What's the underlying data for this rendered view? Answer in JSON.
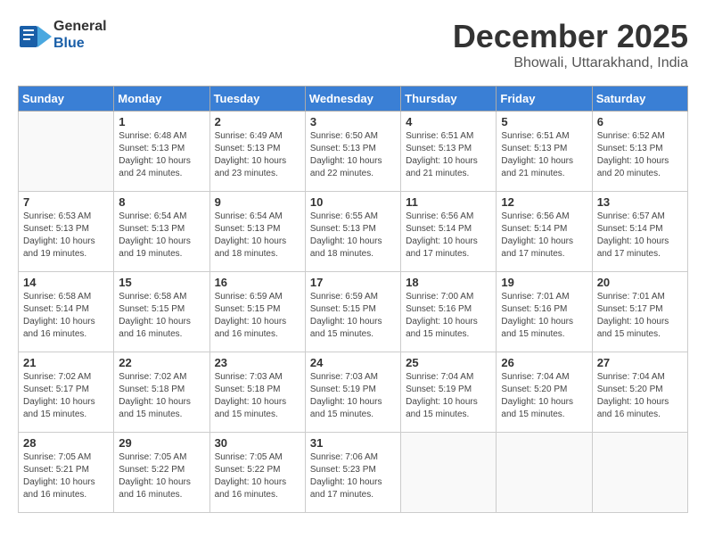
{
  "logo": {
    "general": "General",
    "blue": "Blue"
  },
  "header": {
    "month": "December 2025",
    "location": "Bhowali, Uttarakhand, India"
  },
  "weekdays": [
    "Sunday",
    "Monday",
    "Tuesday",
    "Wednesday",
    "Thursday",
    "Friday",
    "Saturday"
  ],
  "weeks": [
    [
      {
        "day": "",
        "sunrise": "",
        "sunset": "",
        "daylight": ""
      },
      {
        "day": "1",
        "sunrise": "6:48 AM",
        "sunset": "5:13 PM",
        "daylight": "10 hours and 24 minutes."
      },
      {
        "day": "2",
        "sunrise": "6:49 AM",
        "sunset": "5:13 PM",
        "daylight": "10 hours and 23 minutes."
      },
      {
        "day": "3",
        "sunrise": "6:50 AM",
        "sunset": "5:13 PM",
        "daylight": "10 hours and 22 minutes."
      },
      {
        "day": "4",
        "sunrise": "6:51 AM",
        "sunset": "5:13 PM",
        "daylight": "10 hours and 21 minutes."
      },
      {
        "day": "5",
        "sunrise": "6:51 AM",
        "sunset": "5:13 PM",
        "daylight": "10 hours and 21 minutes."
      },
      {
        "day": "6",
        "sunrise": "6:52 AM",
        "sunset": "5:13 PM",
        "daylight": "10 hours and 20 minutes."
      }
    ],
    [
      {
        "day": "7",
        "sunrise": "6:53 AM",
        "sunset": "5:13 PM",
        "daylight": "10 hours and 19 minutes."
      },
      {
        "day": "8",
        "sunrise": "6:54 AM",
        "sunset": "5:13 PM",
        "daylight": "10 hours and 19 minutes."
      },
      {
        "day": "9",
        "sunrise": "6:54 AM",
        "sunset": "5:13 PM",
        "daylight": "10 hours and 18 minutes."
      },
      {
        "day": "10",
        "sunrise": "6:55 AM",
        "sunset": "5:13 PM",
        "daylight": "10 hours and 18 minutes."
      },
      {
        "day": "11",
        "sunrise": "6:56 AM",
        "sunset": "5:14 PM",
        "daylight": "10 hours and 17 minutes."
      },
      {
        "day": "12",
        "sunrise": "6:56 AM",
        "sunset": "5:14 PM",
        "daylight": "10 hours and 17 minutes."
      },
      {
        "day": "13",
        "sunrise": "6:57 AM",
        "sunset": "5:14 PM",
        "daylight": "10 hours and 17 minutes."
      }
    ],
    [
      {
        "day": "14",
        "sunrise": "6:58 AM",
        "sunset": "5:14 PM",
        "daylight": "10 hours and 16 minutes."
      },
      {
        "day": "15",
        "sunrise": "6:58 AM",
        "sunset": "5:15 PM",
        "daylight": "10 hours and 16 minutes."
      },
      {
        "day": "16",
        "sunrise": "6:59 AM",
        "sunset": "5:15 PM",
        "daylight": "10 hours and 16 minutes."
      },
      {
        "day": "17",
        "sunrise": "6:59 AM",
        "sunset": "5:15 PM",
        "daylight": "10 hours and 15 minutes."
      },
      {
        "day": "18",
        "sunrise": "7:00 AM",
        "sunset": "5:16 PM",
        "daylight": "10 hours and 15 minutes."
      },
      {
        "day": "19",
        "sunrise": "7:01 AM",
        "sunset": "5:16 PM",
        "daylight": "10 hours and 15 minutes."
      },
      {
        "day": "20",
        "sunrise": "7:01 AM",
        "sunset": "5:17 PM",
        "daylight": "10 hours and 15 minutes."
      }
    ],
    [
      {
        "day": "21",
        "sunrise": "7:02 AM",
        "sunset": "5:17 PM",
        "daylight": "10 hours and 15 minutes."
      },
      {
        "day": "22",
        "sunrise": "7:02 AM",
        "sunset": "5:18 PM",
        "daylight": "10 hours and 15 minutes."
      },
      {
        "day": "23",
        "sunrise": "7:03 AM",
        "sunset": "5:18 PM",
        "daylight": "10 hours and 15 minutes."
      },
      {
        "day": "24",
        "sunrise": "7:03 AM",
        "sunset": "5:19 PM",
        "daylight": "10 hours and 15 minutes."
      },
      {
        "day": "25",
        "sunrise": "7:04 AM",
        "sunset": "5:19 PM",
        "daylight": "10 hours and 15 minutes."
      },
      {
        "day": "26",
        "sunrise": "7:04 AM",
        "sunset": "5:20 PM",
        "daylight": "10 hours and 15 minutes."
      },
      {
        "day": "27",
        "sunrise": "7:04 AM",
        "sunset": "5:20 PM",
        "daylight": "10 hours and 16 minutes."
      }
    ],
    [
      {
        "day": "28",
        "sunrise": "7:05 AM",
        "sunset": "5:21 PM",
        "daylight": "10 hours and 16 minutes."
      },
      {
        "day": "29",
        "sunrise": "7:05 AM",
        "sunset": "5:22 PM",
        "daylight": "10 hours and 16 minutes."
      },
      {
        "day": "30",
        "sunrise": "7:05 AM",
        "sunset": "5:22 PM",
        "daylight": "10 hours and 16 minutes."
      },
      {
        "day": "31",
        "sunrise": "7:06 AM",
        "sunset": "5:23 PM",
        "daylight": "10 hours and 17 minutes."
      },
      {
        "day": "",
        "sunrise": "",
        "sunset": "",
        "daylight": ""
      },
      {
        "day": "",
        "sunrise": "",
        "sunset": "",
        "daylight": ""
      },
      {
        "day": "",
        "sunrise": "",
        "sunset": "",
        "daylight": ""
      }
    ]
  ]
}
